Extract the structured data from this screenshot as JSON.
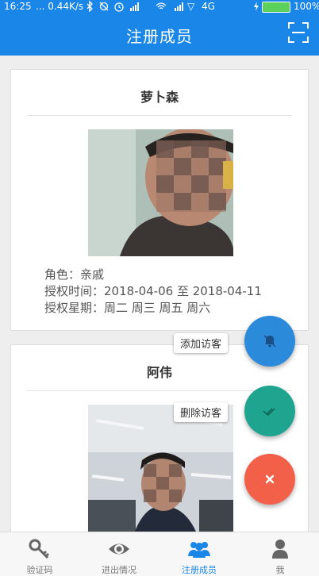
{
  "status_bar": {
    "time": "16:25",
    "network_speed": "... 0.44K/s",
    "carrier": "4G",
    "battery_percent": 100,
    "battery_label": "100%"
  },
  "header": {
    "title": "注册成员",
    "scan_icon": "scan-icon"
  },
  "members": [
    {
      "name": "萝卜森",
      "role": "角色：亲戚",
      "auth_time": "授权时间：2018-04-06  至  2018-04-11",
      "auth_weekdays": "授权星期：周二 周三 周五 周六"
    },
    {
      "name": "阿伟"
    }
  ],
  "fab_menu": {
    "add_visitor": "添加访客",
    "delete_visitor": "删除访客",
    "colors": {
      "mute": "#2b8ad9",
      "check": "#1fa58f",
      "close": "#f26049"
    }
  },
  "bottom_nav": {
    "items": [
      {
        "label": "验证码",
        "icon": "key-icon"
      },
      {
        "label": "进出情况",
        "icon": "eye-icon"
      },
      {
        "label": "注册成员",
        "icon": "group-icon",
        "active": true
      },
      {
        "label": "我",
        "icon": "person-icon"
      }
    ]
  },
  "colors": {
    "primary": "#1a86e8",
    "battery": "#5bd15b"
  }
}
